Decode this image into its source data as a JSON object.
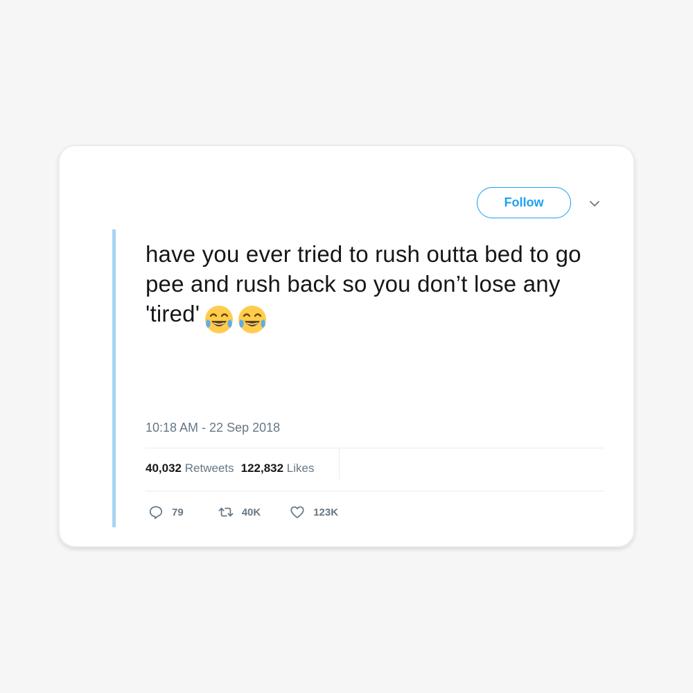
{
  "header": {
    "follow_label": "Follow",
    "menu_icon": "chevron-down-icon"
  },
  "tweet": {
    "text": "have you ever tried to rush outta bed to go pee and rush back so you don’t lose any 'tired'",
    "emoji": [
      "face-with-tears-of-joy",
      "face-with-tears-of-joy"
    ],
    "timestamp": "10:18 AM - 22 Sep 2018"
  },
  "stats": {
    "retweets_count": "40,032",
    "retweets_label": "Retweets",
    "likes_count": "122,832",
    "likes_label": "Likes"
  },
  "actions": {
    "reply_count": "79",
    "retweet_count": "40K",
    "like_count": "123K"
  },
  "colors": {
    "accent": "#1da1f2",
    "quote_bar": "#a6d5f3",
    "text": "#14171a",
    "muted": "#657786"
  }
}
